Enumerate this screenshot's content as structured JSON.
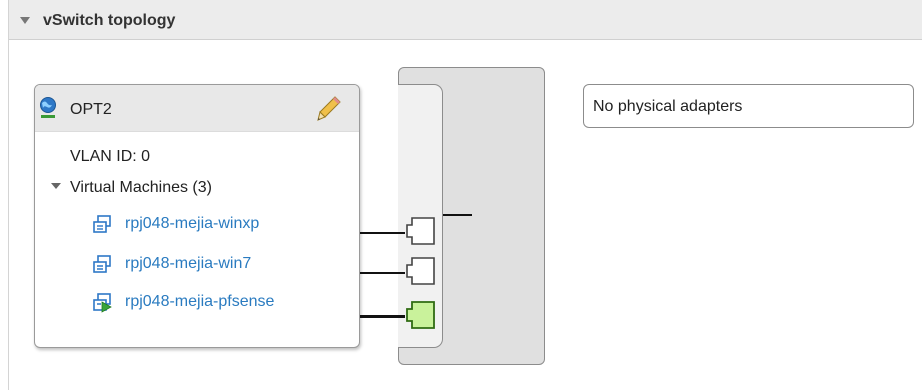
{
  "panel": {
    "title": "vSwitch topology"
  },
  "port_group": {
    "name": "OPT2",
    "icon": "network-globe-icon",
    "edit_icon": "pencil-icon",
    "vlan_label": "VLAN ID: 0",
    "vms_header": "Virtual Machines (3)",
    "virtual_machines": [
      {
        "name": "rpj048-mejia-winxp",
        "state": "stopped",
        "icon": "vm-icon"
      },
      {
        "name": "rpj048-mejia-win7",
        "state": "stopped",
        "icon": "vm-icon"
      },
      {
        "name": "rpj048-mejia-pfsense",
        "state": "running",
        "icon": "vm-running-icon"
      }
    ]
  },
  "uplinks": {
    "label": "No physical adapters"
  },
  "colors": {
    "link": "#2a7bc0",
    "port_active": "#c9f29b",
    "port_inactive": "#ffffff"
  }
}
